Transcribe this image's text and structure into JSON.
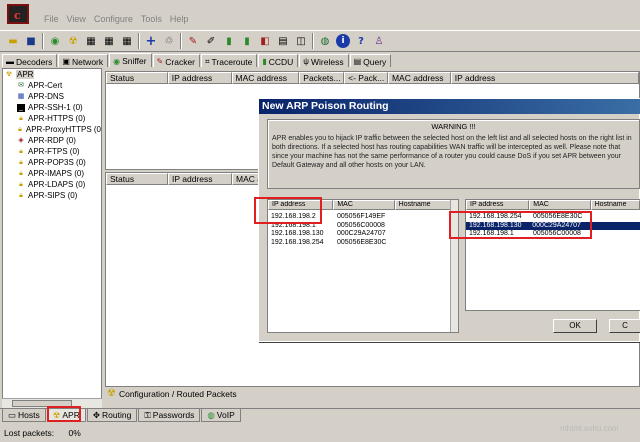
{
  "app": {
    "logo_text": "c"
  },
  "menu": [
    "File",
    "View",
    "Configure",
    "Tools",
    "Help"
  ],
  "toolbar_icons": [
    "open-icon",
    "save-icon",
    "sniffer-icon",
    "network-icon",
    "grid-icon",
    "grid2-icon",
    "add-icon",
    "delete-icon",
    "cracker-icon",
    "pen-icon",
    "battery-icon",
    "battery2-icon",
    "hash-icon",
    "db-icon",
    "tape-icon",
    "web-icon",
    "info-icon",
    "help-icon",
    "user-icon"
  ],
  "tabs": [
    {
      "label": "Decoders"
    },
    {
      "label": "Network"
    },
    {
      "label": "Sniffer"
    },
    {
      "label": "Cracker"
    },
    {
      "label": "Traceroute"
    },
    {
      "label": "CCDU"
    },
    {
      "label": "Wireless"
    },
    {
      "label": "Query"
    }
  ],
  "tree": {
    "root": "APR",
    "items": [
      "APR-Cert",
      "APR-DNS",
      "APR-SSH-1 (0)",
      "APR-HTTPS (0)",
      "APR-ProxyHTTPS (0",
      "APR-RDP (0)",
      "APR-FTPS (0)",
      "APR-POP3S (0)",
      "APR-IMAPS (0)",
      "APR-LDAPS (0)",
      "APR-SIPS (0)"
    ]
  },
  "top_grid": {
    "headers": [
      "Status",
      "IP address",
      "MAC address",
      "Packets...",
      "<- Pack...",
      "MAC address",
      "IP address"
    ]
  },
  "mid_grid": {
    "headers": [
      "Status",
      "IP address",
      "MAC a"
    ]
  },
  "config_tab": "Configuration / Routed Packets",
  "bottom_tabs": [
    "Hosts",
    "APR",
    "Routing",
    "Passwords",
    "VoIP"
  ],
  "status": {
    "text": "Lost packets:",
    "value": "0%"
  },
  "dialog": {
    "title": "New ARP Poison Routing",
    "warning_title": "WARNING !!!",
    "warning_text": "APR enables you to hijack IP traffic between the selected host on the left list and all selected hosts on the right list in both directions. If a selected host has routing capabilities WAN traffic will be intercepted as well. Please note that since your machine has not the same performance of a router you could cause DoS if you set APR between your Default Gateway and all other hosts on your LAN.",
    "left_headers": [
      "IP address",
      "MAC",
      "Hostname"
    ],
    "left_rows": [
      [
        "192.168.198.2",
        "005056F149EF",
        ""
      ],
      [
        "192.168.198.1",
        "005056C00008",
        ""
      ],
      [
        "192.168.198.130",
        "000C29A24707",
        ""
      ],
      [
        "192.168.198.254",
        "005056E8E30C",
        ""
      ]
    ],
    "right_headers": [
      "IP address",
      "MAC",
      "Hostname"
    ],
    "right_rows": [
      [
        "192.168.198.254",
        "005056E8E30C",
        ""
      ],
      [
        "192.168.198.130",
        "000C29A24707",
        ""
      ],
      [
        "192.168.198.1",
        "005056C00008",
        ""
      ]
    ],
    "ok_label": "OK",
    "cancel_label": "C"
  },
  "watermark": "mhtml.sohu.com",
  "colors": {
    "title_bar": "#0a246a",
    "highlight": "#e02020",
    "selection": "#0a246a"
  }
}
